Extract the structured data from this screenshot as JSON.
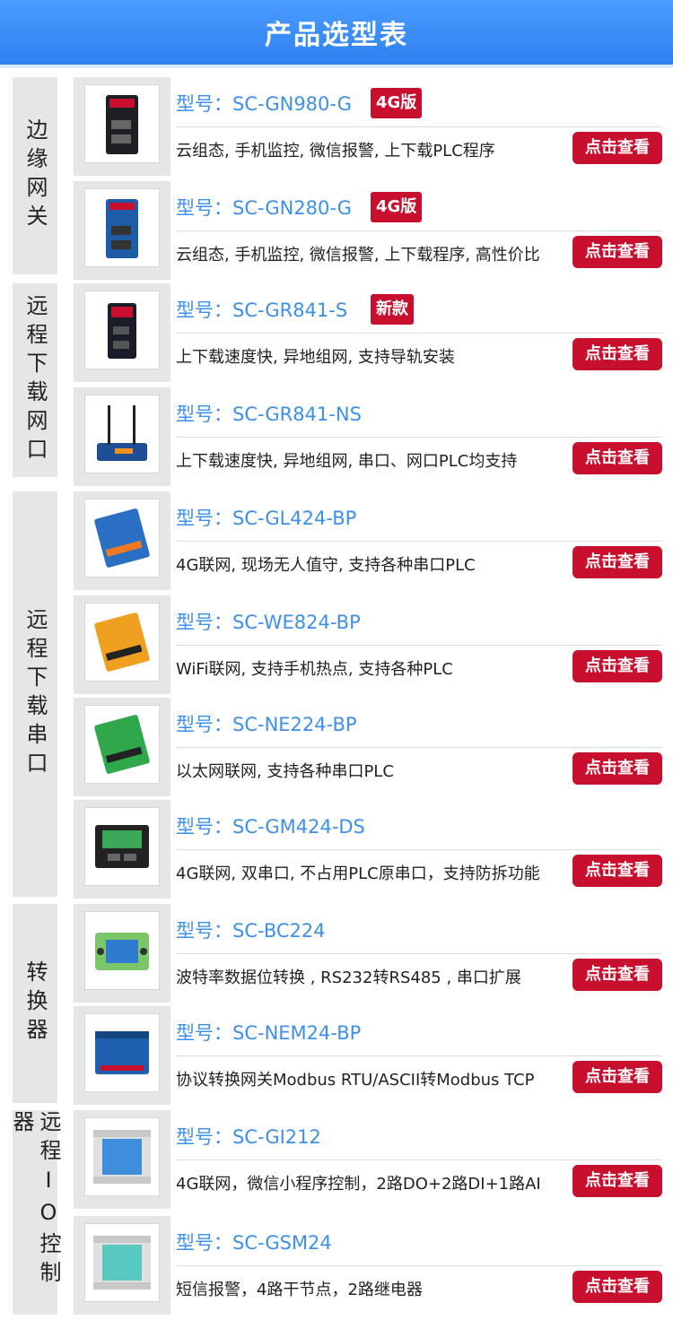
{
  "header": {
    "title": "产品选型表"
  },
  "categories": [
    {
      "label": "边缘网关"
    },
    {
      "label": "远程下载网口"
    },
    {
      "label": "远程下载串口"
    },
    {
      "label": "转换器"
    },
    {
      "label": "远程IO控制器"
    }
  ],
  "products": [
    {
      "model": "型号：SC-GN980-G",
      "badge": "4G版",
      "desc": "云组态, 手机监控, 微信报警, 上下载PLC程序",
      "button": "点击查看",
      "image_icon": "industrial-gateway-image"
    },
    {
      "model": "型号：SC-GN280-G",
      "badge": "4G版",
      "desc": "云组态, 手机监控, 微信报警, 上下载程序, 高性价比",
      "button": "点击查看",
      "image_icon": "industrial-gateway-image"
    },
    {
      "model": "型号：SC-GR841-S",
      "badge": "新款",
      "desc": "上下载速度快, 异地组网, 支持导轨安装",
      "button": "点击查看",
      "image_icon": "router-image"
    },
    {
      "model": "型号：SC-GR841-NS",
      "badge": "",
      "desc": "上下载速度快, 异地组网, 串口、网口PLC均支持",
      "button": "点击查看",
      "image_icon": "antenna-router-image"
    },
    {
      "model": "型号：SC-GL424-BP",
      "badge": "",
      "desc": "4G联网, 现场无人值守, 支持各种串口PLC",
      "button": "点击查看",
      "image_icon": "serial-module-image"
    },
    {
      "model": "型号：SC-WE824-BP",
      "badge": "",
      "desc": "WiFi联网, 支持手机热点, 支持各种PLC",
      "button": "点击查看",
      "image_icon": "serial-module-image"
    },
    {
      "model": "型号：SC-NE224-BP",
      "badge": "",
      "desc": "以太网联网, 支持各种串口PLC",
      "button": "点击查看",
      "image_icon": "serial-module-image"
    },
    {
      "model": "型号：SC-GM424-DS",
      "badge": "",
      "desc": "4G联网, 双串口, 不占用PLC原串口，支持防拆功能",
      "button": "点击查看",
      "image_icon": "dual-serial-module-image"
    },
    {
      "model": "型号：SC-BC224",
      "badge": "",
      "desc": "波特率数据位转换 , RS232转RS485 , 串口扩展",
      "button": "点击查看",
      "image_icon": "converter-image"
    },
    {
      "model": "型号：SC-NEM24-BP",
      "badge": "",
      "desc": "协议转换网关Modbus RTU/ASCII转Modbus TCP",
      "button": "点击查看",
      "image_icon": "protocol-gateway-image"
    },
    {
      "model": "型号：SC-GI212",
      "badge": "",
      "desc": "4G联网，微信小程序控制，2路DO+2路DI+1路AI",
      "button": "点击查看",
      "image_icon": "io-controller-image"
    },
    {
      "model": "型号：SC-GSM24",
      "badge": "",
      "desc": "短信报警，4路干节点，2路继电器",
      "button": "点击查看",
      "image_icon": "io-controller-image"
    }
  ],
  "colors": {
    "header": "#3d8fec",
    "model_text": "#3d8fec",
    "badge": "#c8102e",
    "button": "#c8102e",
    "panel": "#e6e6e6"
  }
}
